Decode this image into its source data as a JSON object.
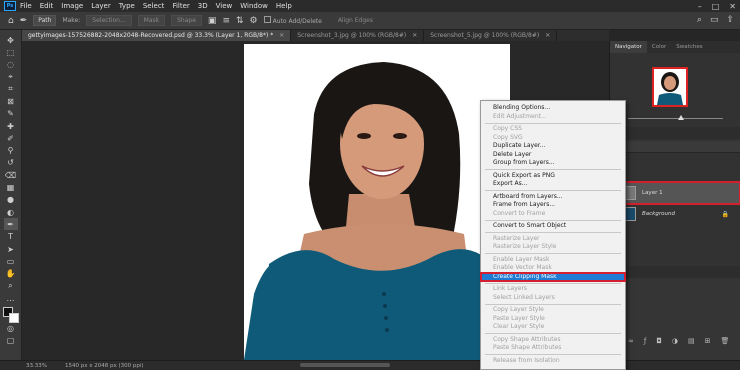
{
  "menubar": {
    "items": [
      "File",
      "Edit",
      "Image",
      "Layer",
      "Type",
      "Select",
      "Filter",
      "3D",
      "View",
      "Window",
      "Help"
    ],
    "window_controls": [
      "–",
      "□",
      "✕"
    ]
  },
  "options_bar": {
    "mode_value": "Path",
    "make_label": "Make:",
    "selection_btn": "Selection...",
    "mask_btn": "Mask",
    "shape_btn": "Shape",
    "auto_add_delete": "Auto Add/Delete",
    "align_edges": "Align Edges"
  },
  "tabs": [
    {
      "label": "gettyimages-157526882-2048x2048-Recovered.psd @ 33.3% (Layer 1, RGB/8*) *",
      "active": true
    },
    {
      "label": "Screenshot_3.jpg @ 100% (RGB/8#)",
      "active": false
    },
    {
      "label": "Screenshot_5.jpg @ 100% (RGB/8#)",
      "active": false
    }
  ],
  "status": {
    "zoom": "33.33%",
    "doc_info": "1540 px x 2048 px (300 ppi)"
  },
  "panels": {
    "tabs": [
      "Navigator",
      "Color",
      "Swatches"
    ],
    "layers": [
      {
        "name": "Layer 1",
        "selected": true
      },
      {
        "name": "Background",
        "selected": false
      }
    ]
  },
  "context_menu": {
    "groups": [
      [
        {
          "label": "Blending Options...",
          "enabled": true
        },
        {
          "label": "Edit Adjustment...",
          "enabled": false
        }
      ],
      [
        {
          "label": "Copy CSS",
          "enabled": false
        },
        {
          "label": "Copy SVG",
          "enabled": false
        },
        {
          "label": "Duplicate Layer...",
          "enabled": true
        },
        {
          "label": "Delete Layer",
          "enabled": true
        },
        {
          "label": "Group from Layers...",
          "enabled": true
        }
      ],
      [
        {
          "label": "Quick Export as PNG",
          "enabled": true
        },
        {
          "label": "Export As...",
          "enabled": true
        }
      ],
      [
        {
          "label": "Artboard from Layers...",
          "enabled": true
        },
        {
          "label": "Frame from Layers...",
          "enabled": true
        },
        {
          "label": "Convert to Frame",
          "enabled": false
        }
      ],
      [
        {
          "label": "Convert to Smart Object",
          "enabled": true
        }
      ],
      [
        {
          "label": "Rasterize Layer",
          "enabled": false
        },
        {
          "label": "Rasterize Layer Style",
          "enabled": false
        }
      ],
      [
        {
          "label": "Enable Layer Mask",
          "enabled": false
        },
        {
          "label": "Enable Vector Mask",
          "enabled": false
        },
        {
          "label": "Create Clipping Mask",
          "enabled": true,
          "highlighted": true
        }
      ],
      [
        {
          "label": "Link Layers",
          "enabled": false
        },
        {
          "label": "Select Linked Layers",
          "enabled": false
        }
      ],
      [
        {
          "label": "Copy Layer Style",
          "enabled": false
        },
        {
          "label": "Paste Layer Style",
          "enabled": false
        },
        {
          "label": "Clear Layer Style",
          "enabled": false
        }
      ],
      [
        {
          "label": "Copy Shape Attributes",
          "enabled": false
        },
        {
          "label": "Paste Shape Attributes",
          "enabled": false
        }
      ],
      [
        {
          "label": "Release from Isolation",
          "enabled": false
        }
      ]
    ]
  }
}
